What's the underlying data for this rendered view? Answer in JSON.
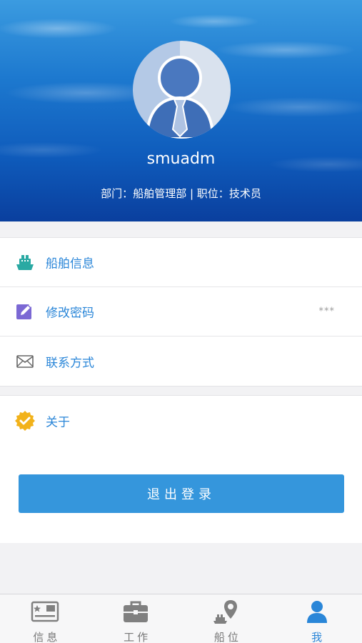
{
  "profile": {
    "username": "smuadm",
    "department_label": "部门：",
    "department": "船舶管理部",
    "separator": " | ",
    "position_label": "职位：",
    "position": "技术员"
  },
  "menu": {
    "ship_info": {
      "label": "船舶信息",
      "icon": "ship-icon"
    },
    "change_password": {
      "label": "修改密码",
      "value": "***",
      "icon": "edit-icon"
    },
    "contact": {
      "label": "联系方式",
      "icon": "mail-icon"
    },
    "about": {
      "label": "关于",
      "icon": "verified-badge-icon"
    }
  },
  "logout": {
    "label": "退出登录"
  },
  "tabbar": {
    "tabs": [
      {
        "label": "信息",
        "icon": "message-card-icon",
        "active": false
      },
      {
        "label": "工作",
        "icon": "briefcase-icon",
        "active": false
      },
      {
        "label": "船位",
        "icon": "ship-location-icon",
        "active": false
      },
      {
        "label": "我",
        "icon": "person-icon",
        "active": true
      }
    ]
  },
  "colors": {
    "accent": "#2a86d8",
    "button": "#3596dc",
    "ship_icon": "#2aa9a3",
    "edit_icon": "#7b68d4",
    "badge_icon": "#f2b21a"
  }
}
